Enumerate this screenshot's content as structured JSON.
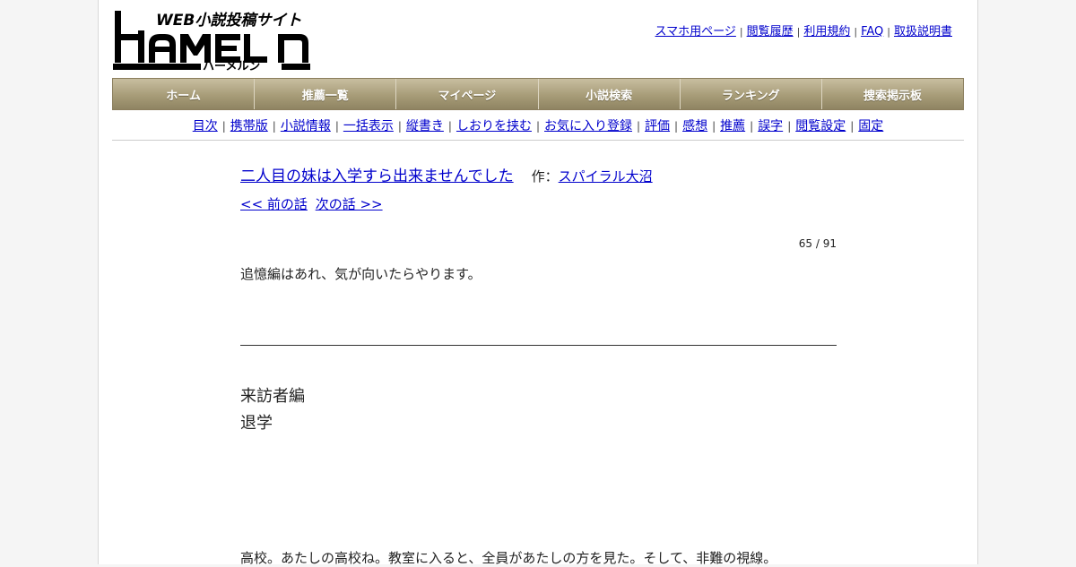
{
  "logo": {
    "tagline": "WEB小説投稿サイト",
    "name": "HAMELN",
    "kana": "ハーメルン"
  },
  "toplinks": [
    "スマホ用ページ",
    "閲覧履歴",
    "利用規約",
    "FAQ",
    "取扱説明書"
  ],
  "menu": [
    "ホーム",
    "推薦一覧",
    "マイページ",
    "小説検索",
    "ランキング",
    "捜索掲示板"
  ],
  "subnav": [
    "目次",
    "携帯版",
    "小説情報",
    "一括表示",
    "縦書き",
    "しおりを挟む",
    "お気に入り登録",
    "評価",
    "感想",
    "推薦",
    "誤字",
    "閲覧設定",
    "固定"
  ],
  "novel": {
    "title": "二人目の妹は入学すら出来ませんでした",
    "author_label": "作：",
    "author": "スパイラル大沼",
    "prev": "<< 前の話",
    "next": "次の話 >>",
    "page_indicator": "65 / 91",
    "preface": "追憶編はあれ、気が向いたらやります。",
    "chapter_arc": "来訪者編",
    "chapter_title": "退学",
    "body_first_line": "高校。あたしの高校ね。教室に入ると、全員があたしの方を見た。そして、非難の視線。"
  },
  "colors": {
    "menubar": "#a79c78",
    "link": "#0000cc",
    "background": "#f5f5f5",
    "page": "#ffffff"
  }
}
